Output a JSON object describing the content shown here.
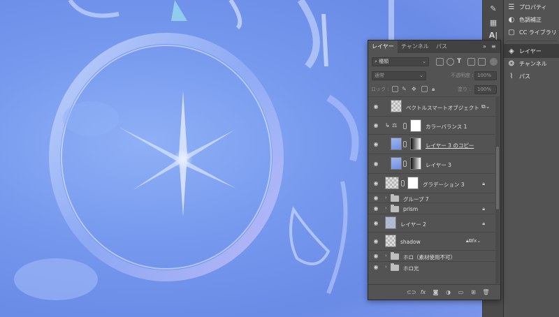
{
  "dock": {
    "items": [
      {
        "label": "プロパティ",
        "icon": "properties-icon"
      },
      {
        "label": "色調補正",
        "icon": "adjustments-icon"
      },
      {
        "label": "CC ライブラリ",
        "icon": "libraries-icon"
      },
      {
        "label": "レイヤー",
        "icon": "layers-icon",
        "active": true
      },
      {
        "label": "チャンネル",
        "icon": "channels-icon"
      },
      {
        "label": "パス",
        "icon": "paths-icon"
      }
    ]
  },
  "layers_panel": {
    "tabs": [
      "レイヤー",
      "チャンネル",
      "パス"
    ],
    "filter": {
      "value": "種類"
    },
    "blend_mode": {
      "value": "通常"
    },
    "opacity": {
      "label": "不透明度 :",
      "value": "100%"
    },
    "lock": {
      "label": "ロック :"
    },
    "fill": {
      "label": "塗り :",
      "value": "100%"
    },
    "layers": [
      {
        "name": "ベクトルスマートオブジェクト",
        "type": "smart-object"
      },
      {
        "name": "カラーバランス 1",
        "type": "adjustment"
      },
      {
        "name": "レイヤー 3 のコピー",
        "type": "pixel-mask"
      },
      {
        "name": "レイヤー 3",
        "type": "pixel-mask"
      },
      {
        "name": "グラデーション 3",
        "type": "gradient"
      },
      {
        "name": "グループ 7",
        "type": "group"
      },
      {
        "name": "prism",
        "type": "group"
      },
      {
        "name": "レイヤー 2",
        "type": "pixel"
      },
      {
        "name": "shadow",
        "type": "pixel"
      },
      {
        "name": "ホロ（素材使用不可）",
        "type": "group"
      },
      {
        "name": "ホロ光",
        "type": "group"
      }
    ]
  },
  "colors": {
    "canvas_blue": "#7699ee",
    "panel_bg": "#535353",
    "tabbar_bg": "#424242"
  }
}
